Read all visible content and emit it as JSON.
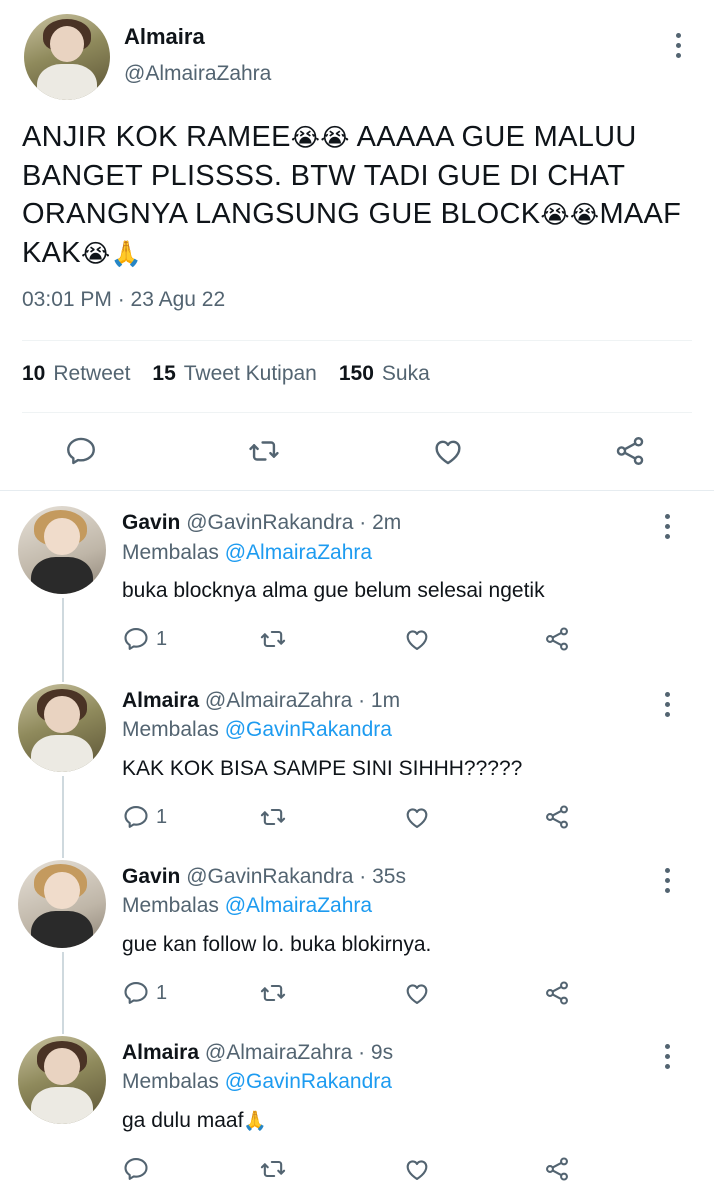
{
  "main": {
    "name": "Almaira",
    "handle": "@AlmairaZahra",
    "text_parts": [
      "ANJIR KOK RAMEE",
      "😭😭",
      " AAAAA GUE MALUU BANGET PLISSSS. BTW TADI GUE DI CHAT ORANGNYA LANGSUNG GUE BLOCK",
      "😭😭",
      "MAAF KAK",
      "😭🙏"
    ],
    "timestamp": "03:01 PM · 23 Agu 22",
    "retweets_count": "10",
    "retweets_label": "Retweet",
    "quotes_count": "15",
    "quotes_label": "Tweet Kutipan",
    "likes_count": "150",
    "likes_label": "Suka"
  },
  "replies": [
    {
      "name": "Gavin",
      "meta": "@GavinRakandra · 2m",
      "replying_prefix": "Membalas",
      "replying_to": "@AlmairaZahra",
      "text": "buka blocknya alma gue belum selesai ngetik",
      "reply_count": "1"
    },
    {
      "name": "Almaira",
      "meta": "@AlmairaZahra · 1m",
      "replying_prefix": "Membalas",
      "replying_to": "@GavinRakandra",
      "text": "KAK KOK BISA SAMPE SINI SIHHH?????",
      "reply_count": "1"
    },
    {
      "name": "Gavin",
      "meta": "@GavinRakandra · 35s",
      "replying_prefix": "Membalas",
      "replying_to": "@AlmairaZahra",
      "text": "gue kan follow lo. buka blokirnya.",
      "reply_count": "1"
    },
    {
      "name": "Almaira",
      "meta": "@AlmairaZahra · 9s",
      "replying_prefix": "Membalas",
      "replying_to": "@GavinRakandra",
      "text": "ga dulu maaf",
      "text_emoji": "🙏",
      "reply_count": ""
    }
  ],
  "icons": [
    "reply-icon",
    "retweet-icon",
    "like-icon",
    "share-icon",
    "more-icon"
  ],
  "colors": {
    "text": "#0f1419",
    "muted": "#536471",
    "link": "#1d9bf0",
    "divider": "#eff3f4"
  }
}
